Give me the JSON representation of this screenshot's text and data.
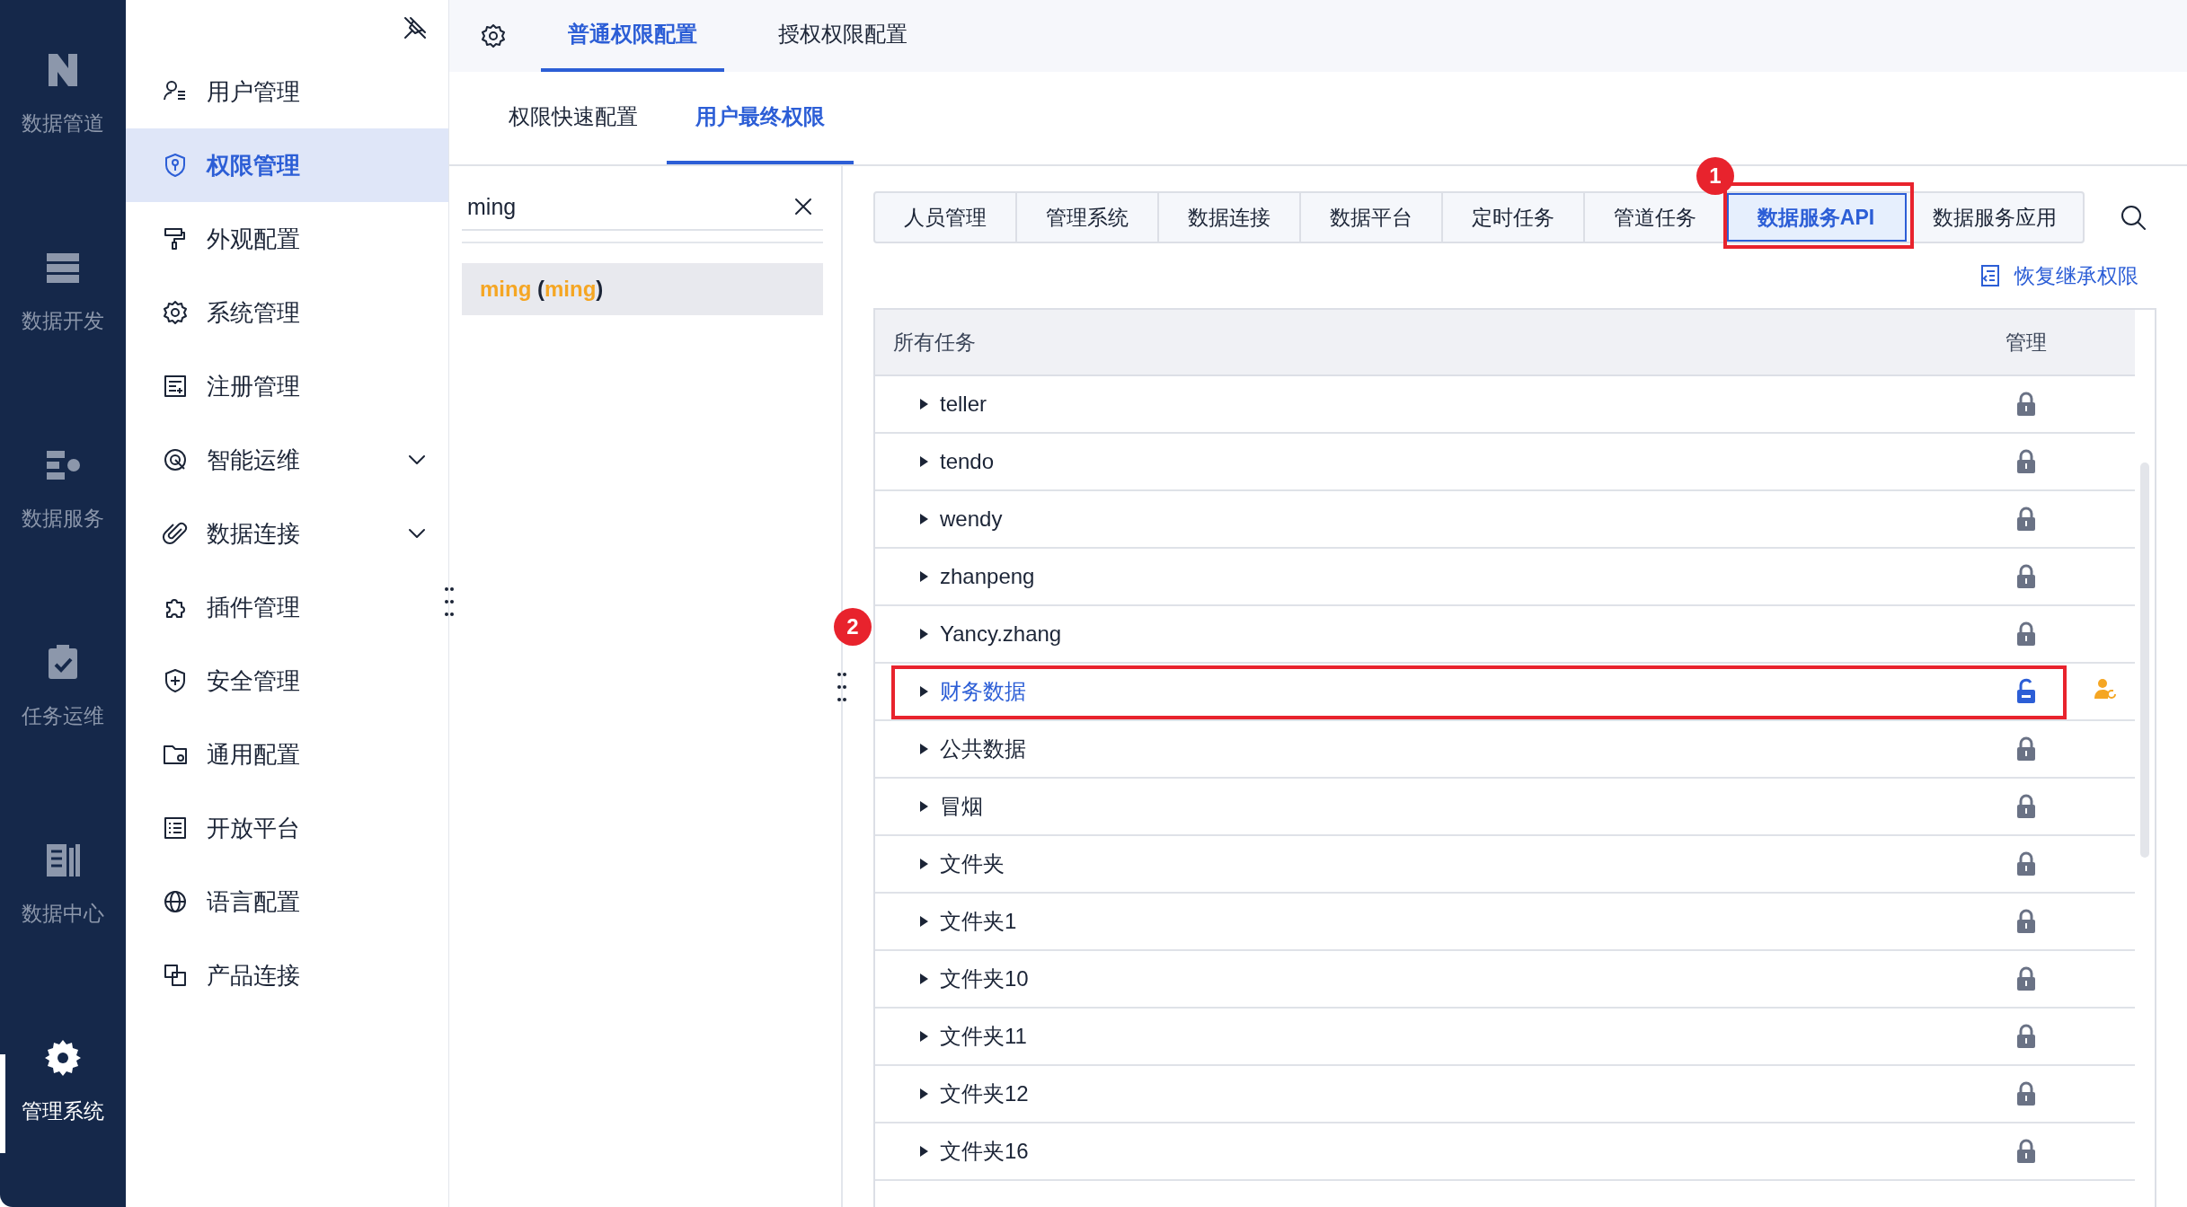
{
  "rail": [
    {
      "label": "数据管道",
      "selected": false
    },
    {
      "label": "数据开发",
      "selected": false
    },
    {
      "label": "数据服务",
      "selected": false
    },
    {
      "label": "任务运维",
      "selected": false
    },
    {
      "label": "数据中心",
      "selected": false
    },
    {
      "label": "管理系统",
      "selected": true
    }
  ],
  "menu": [
    {
      "label": "用户管理",
      "selected": false,
      "expandable": false
    },
    {
      "label": "权限管理",
      "selected": true,
      "expandable": false
    },
    {
      "label": "外观配置",
      "selected": false,
      "expandable": false
    },
    {
      "label": "系统管理",
      "selected": false,
      "expandable": false
    },
    {
      "label": "注册管理",
      "selected": false,
      "expandable": false
    },
    {
      "label": "智能运维",
      "selected": false,
      "expandable": true
    },
    {
      "label": "数据连接",
      "selected": false,
      "expandable": true
    },
    {
      "label": "插件管理",
      "selected": false,
      "expandable": false
    },
    {
      "label": "安全管理",
      "selected": false,
      "expandable": false
    },
    {
      "label": "通用配置",
      "selected": false,
      "expandable": false
    },
    {
      "label": "开放平台",
      "selected": false,
      "expandable": false
    },
    {
      "label": "语言配置",
      "selected": false,
      "expandable": false
    },
    {
      "label": "产品连接",
      "selected": false,
      "expandable": false
    }
  ],
  "top_tabs": [
    {
      "label": "普通权限配置",
      "selected": true
    },
    {
      "label": "授权权限配置",
      "selected": false
    }
  ],
  "sub_tabs": [
    {
      "label": "权限快速配置",
      "selected": false
    },
    {
      "label": "用户最终权限",
      "selected": true
    }
  ],
  "user_search": {
    "value": "ming"
  },
  "users": [
    {
      "parts": [
        {
          "text": "ming",
          "match": true
        },
        {
          "text": " (",
          "match": false
        },
        {
          "text": "ming",
          "match": true
        },
        {
          "text": ")",
          "match": false
        }
      ],
      "selected": true
    }
  ],
  "module_tabs": [
    {
      "label": "人员管理",
      "selected": false
    },
    {
      "label": "管理系统",
      "selected": false
    },
    {
      "label": "数据连接",
      "selected": false
    },
    {
      "label": "数据平台",
      "selected": false
    },
    {
      "label": "定时任务",
      "selected": false
    },
    {
      "label": "管道任务",
      "selected": false
    },
    {
      "label": "数据服务API",
      "selected": true,
      "annotation": "1"
    },
    {
      "label": "数据服务应用",
      "selected": false
    }
  ],
  "restore_link": "恢复继承权限",
  "table": {
    "columns": [
      "所有任务",
      "管理"
    ],
    "rows": [
      {
        "name": "teller",
        "locked": true,
        "selected": false,
        "override": false
      },
      {
        "name": "tendo",
        "locked": true,
        "selected": false,
        "override": false
      },
      {
        "name": "wendy",
        "locked": true,
        "selected": false,
        "override": false
      },
      {
        "name": "zhanpeng",
        "locked": true,
        "selected": false,
        "override": false
      },
      {
        "name": "Yancy.zhang",
        "locked": true,
        "selected": false,
        "override": false
      },
      {
        "name": "财务数据",
        "locked": false,
        "selected": true,
        "override": true,
        "annotation": "2"
      },
      {
        "name": "公共数据",
        "locked": true,
        "selected": false,
        "override": false
      },
      {
        "name": "冒烟",
        "locked": true,
        "selected": false,
        "override": false
      },
      {
        "name": "文件夹",
        "locked": true,
        "selected": false,
        "override": false
      },
      {
        "name": "文件夹1",
        "locked": true,
        "selected": false,
        "override": false
      },
      {
        "name": "文件夹10",
        "locked": true,
        "selected": false,
        "override": false
      },
      {
        "name": "文件夹11",
        "locked": true,
        "selected": false,
        "override": false
      },
      {
        "name": "文件夹12",
        "locked": true,
        "selected": false,
        "override": false
      },
      {
        "name": "文件夹16",
        "locked": true,
        "selected": false,
        "override": false
      }
    ]
  }
}
